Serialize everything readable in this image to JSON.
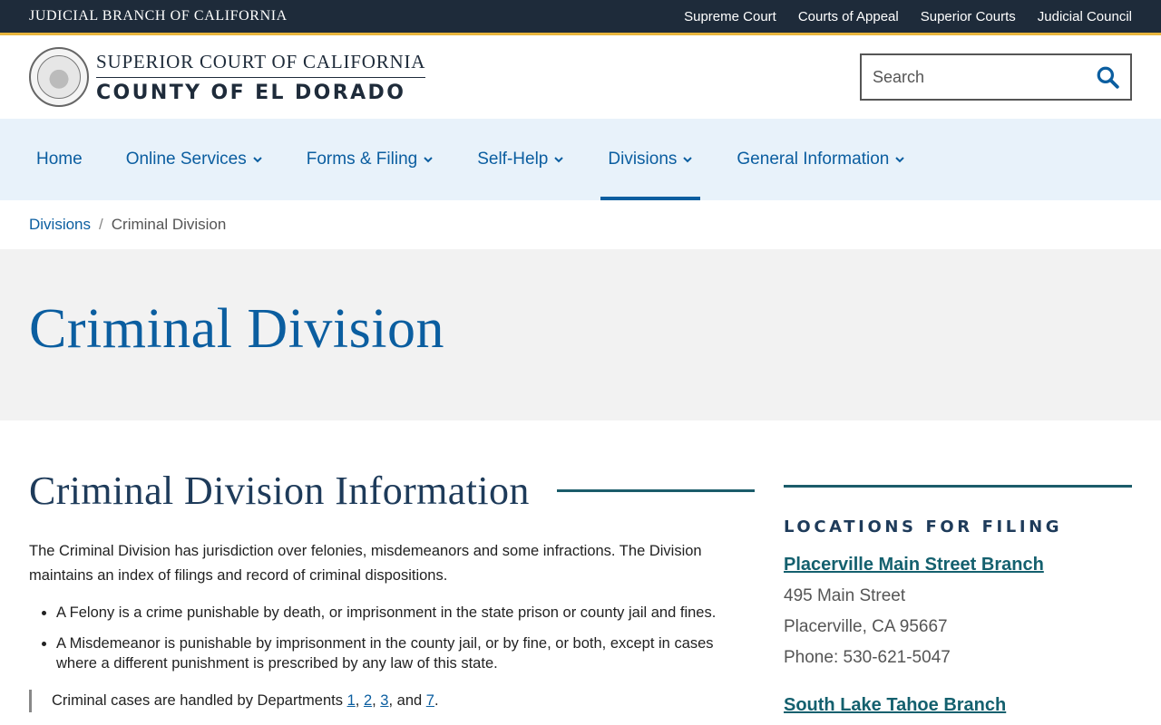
{
  "topbar": {
    "brand": "JUDICIAL BRANCH OF CALIFORNIA",
    "links": [
      "Supreme Court",
      "Courts of Appeal",
      "Superior Courts",
      "Judicial Council"
    ]
  },
  "header": {
    "logo_line1": "SUPERIOR COURT OF CALIFORNIA",
    "logo_line2": "COUNTY OF EL DORADO",
    "search_placeholder": "Search"
  },
  "nav": {
    "items": [
      {
        "label": "Home",
        "has_dropdown": false
      },
      {
        "label": "Online Services",
        "has_dropdown": true
      },
      {
        "label": "Forms & Filing",
        "has_dropdown": true
      },
      {
        "label": "Self-Help",
        "has_dropdown": true
      },
      {
        "label": "Divisions",
        "has_dropdown": true,
        "active": true
      },
      {
        "label": "General Information",
        "has_dropdown": true
      }
    ]
  },
  "breadcrumb": {
    "parent": "Divisions",
    "separator": "/",
    "current": "Criminal Division"
  },
  "hero": {
    "title": "Criminal Division"
  },
  "main": {
    "heading": "Criminal Division Information",
    "intro": "The Criminal Division has jurisdiction over felonies, misdemeanors and some infractions. The Division maintains an index of filings and record of criminal dispositions.",
    "bullets": [
      "A Felony is a crime punishable by death, or imprisonment in the state prison or county jail and fines.",
      "A Misdemeanor is punishable by imprisonment in the county jail, or by fine, or both, except in cases where a different punishment is prescribed by any law of this state."
    ],
    "callout": {
      "prefix": "Criminal cases are handled by Departments ",
      "dept1": "1",
      "comma1": ", ",
      "dept2": "2",
      "comma2": ", ",
      "dept3": "3",
      "and": ", and ",
      "dept4": "7",
      "suffix": "."
    }
  },
  "aside": {
    "heading": "LOCATIONS FOR FILING",
    "locations": [
      {
        "name": "Placerville Main Street Branch",
        "address1": "495 Main Street",
        "address2": "Placerville, CA 95667",
        "phone": "Phone: 530-621-5047"
      },
      {
        "name": "South Lake Tahoe Branch"
      }
    ]
  },
  "colors": {
    "topbar_bg": "#1e2b3a",
    "accent_gold": "#e8b53d",
    "link_blue": "#0b5ea0",
    "nav_bg": "#e8f2fa",
    "hero_bg": "#f2f2f2",
    "teal_rule": "#1b5c6a"
  }
}
